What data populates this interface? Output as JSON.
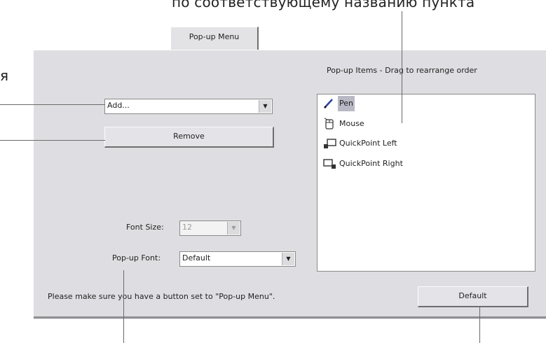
{
  "annotation": {
    "top_caption": "по соответствующему названию пункта",
    "side_char": "я"
  },
  "tab": {
    "label": "Pop-up Menu"
  },
  "list_header": "Pop-up Items - Drag to rearrange order",
  "add_combo": {
    "value": "Add..."
  },
  "remove_button": {
    "label": "Remove"
  },
  "popup_items": [
    {
      "label": "Pen",
      "icon": "pen-icon",
      "selected": true
    },
    {
      "label": "Mouse",
      "icon": "mouse-icon",
      "selected": false
    },
    {
      "label": "QuickPoint Left",
      "icon": "quickpoint-left-icon",
      "selected": false
    },
    {
      "label": "QuickPoint Right",
      "icon": "quickpoint-right-icon",
      "selected": false
    }
  ],
  "font_size": {
    "label": "Font Size:",
    "value": "12"
  },
  "popup_font": {
    "label": "Pop-up Font:",
    "value": "Default"
  },
  "footer_note": "Please make sure you have a button set to \"Pop-up Menu\".",
  "default_button": {
    "label": "Default"
  },
  "colors": {
    "panel": "#dedee2",
    "selection": "#b9b9c6"
  }
}
